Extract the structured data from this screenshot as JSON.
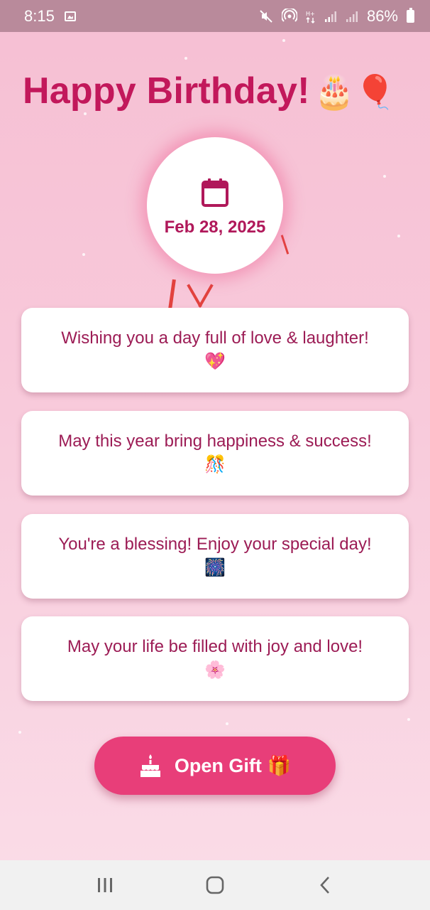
{
  "status_bar": {
    "time": "8:15",
    "battery": "86%",
    "icons": [
      "image-icon",
      "mute-icon",
      "hotspot-icon",
      "data-icon",
      "signal-icon",
      "signal-icon",
      "battery-icon"
    ]
  },
  "header": {
    "title": "Happy Birthday!",
    "title_emoji": "🎂🎈"
  },
  "date_badge": {
    "icon": "calendar-icon",
    "date": "Feb 28, 2025"
  },
  "wishes": [
    {
      "text": "Wishing you a day full of love & laughter!",
      "emoji": "💖"
    },
    {
      "text": "May this year bring happiness & success!",
      "emoji": "🎊"
    },
    {
      "text": "You're a blessing! Enjoy your special day!",
      "emoji": "🎆"
    },
    {
      "text": "May your life be filled with joy and love!",
      "emoji": "🌸"
    }
  ],
  "gift_button": {
    "label": "Open Gift",
    "emoji": "🎁",
    "icon": "cake-icon"
  },
  "nav_bar": {
    "buttons": [
      "recents-icon",
      "home-icon",
      "back-icon"
    ]
  },
  "colors": {
    "title": "#c2185b",
    "accent": "#e83e79",
    "card_text": "#9c1c55",
    "status_bar": "#b98a9b"
  }
}
